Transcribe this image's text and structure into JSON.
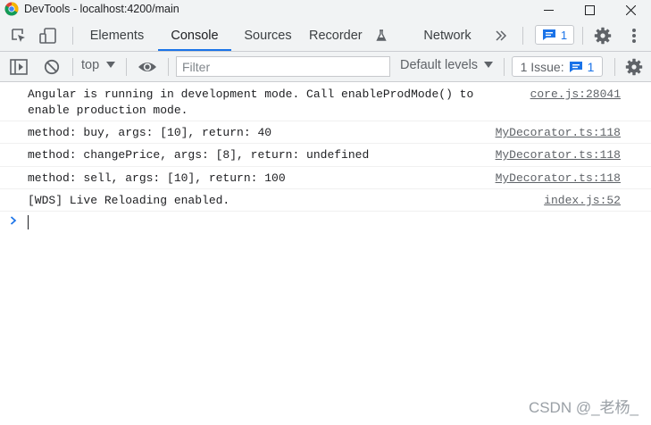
{
  "window": {
    "title": "DevTools - localhost:4200/main"
  },
  "tabs": [
    {
      "label": "Elements",
      "active": false
    },
    {
      "label": "Console",
      "active": true
    },
    {
      "label": "Sources",
      "active": false
    },
    {
      "label": "Recorder",
      "active": false
    },
    {
      "label": "Network",
      "active": false
    }
  ],
  "header": {
    "messages_count": "1"
  },
  "toolbar": {
    "context": "top",
    "filter_placeholder": "Filter",
    "levels_label": "Default levels",
    "issues_label": "1 Issue:",
    "issues_count": "1"
  },
  "console": {
    "messages": [
      {
        "text": "Angular is running in development mode. Call enableProdMode() to\nenable production mode.",
        "source": "core.js:28041"
      },
      {
        "text": "method: buy, args: [10], return: 40",
        "source": "MyDecorator.ts:118"
      },
      {
        "text": "method: changePrice, args: [8], return: undefined",
        "source": "MyDecorator.ts:118"
      },
      {
        "text": "method: sell, args: [10], return: 100",
        "source": "MyDecorator.ts:118"
      },
      {
        "text": "[WDS] Live Reloading enabled.",
        "source": "index.js:52"
      }
    ]
  },
  "watermark": "CSDN @_老杨_",
  "colors": {
    "accent": "#1a73e8",
    "panel_bg": "#f1f3f4",
    "text": "#202124",
    "muted": "#5f6368"
  }
}
